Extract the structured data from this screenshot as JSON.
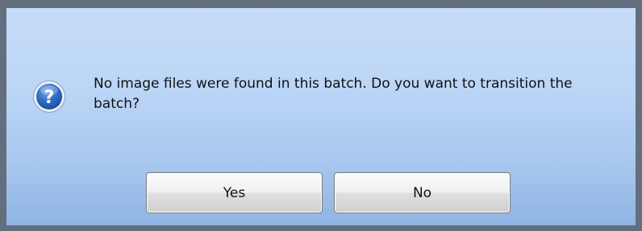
{
  "dialog": {
    "message": "No image files were found in this batch. Do you want to transition the batch?",
    "icon": "question-icon",
    "buttons": {
      "yes_label": "Yes",
      "no_label": "No"
    }
  }
}
